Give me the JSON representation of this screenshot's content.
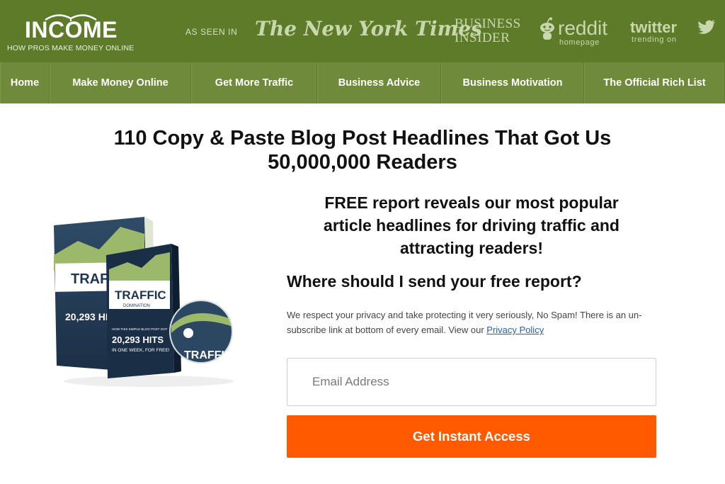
{
  "logo": {
    "word": "INCOME",
    "tagline": "HOW PROS MAKE MONEY ONLINE"
  },
  "press": {
    "label": "AS SEEN IN",
    "nyt": "The New York Times",
    "bi_line1": "BUSINESS",
    "bi_line2": "INSIDER",
    "reddit": "reddit",
    "reddit_sub": "homepage",
    "twitter": "twitter",
    "twitter_sub": "trending on"
  },
  "nav": [
    {
      "label": "Home"
    },
    {
      "label": "Make Money Online"
    },
    {
      "label": "Get More Traffic"
    },
    {
      "label": "Business Advice"
    },
    {
      "label": "Business Motivation"
    },
    {
      "label": "The Official Rich List"
    }
  ],
  "headline": {
    "line1": "110 Copy & Paste Blog Post Headlines That Got Us",
    "line2": "50,000,000 Readers"
  },
  "product": {
    "title": "TRAFFIC",
    "subtitle": "DOMINATION",
    "blurb": "HOW THIS SIMPLE BLOG POST GOT",
    "hits": "20,293 HITS",
    "period": "IN ONE WEEK, FOR FREE!"
  },
  "offer": {
    "subhead_line1": "FREE report reveals our most popular",
    "subhead_line2": "article headlines for driving traffic and",
    "subhead_line3": "attracting readers!",
    "question": "Where should I send your free report?",
    "privacy_text": "We respect your privacy and take protecting it very seriously, No Spam! There is an un-subscribe link at bottom of every email. View our ",
    "privacy_link": "Privacy Policy"
  },
  "form": {
    "email_placeholder": "Email Address",
    "email_value": "",
    "submit_label": "Get Instant Access"
  },
  "colors": {
    "header": "#5d7b28",
    "nav": "#6e8a3a",
    "cta": "#ff5a00",
    "link": "#2a5db0"
  }
}
